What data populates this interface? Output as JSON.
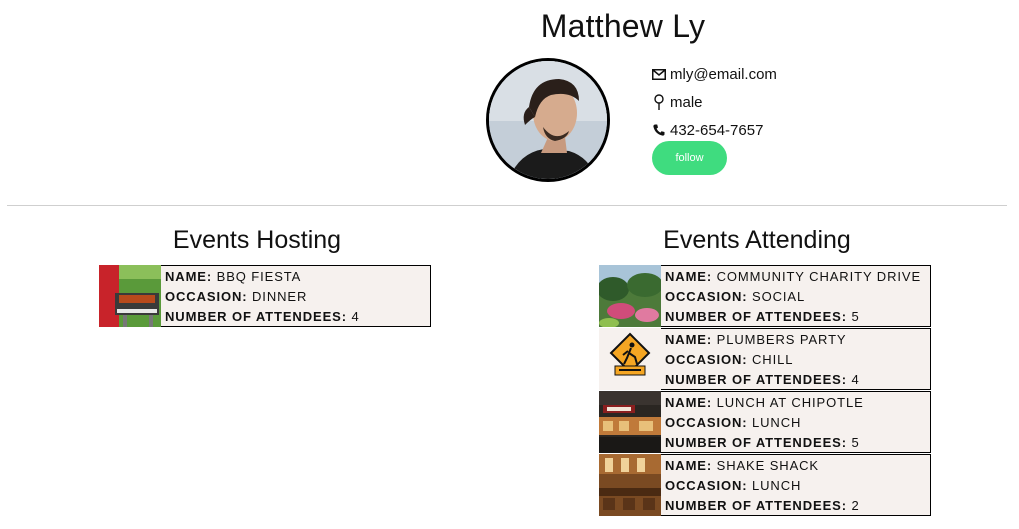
{
  "profile": {
    "name": "Matthew Ly",
    "email": "mly@email.com",
    "gender": "male",
    "phone": "432-654-7657",
    "follow_label": "follow",
    "icons": {
      "email": "envelope-icon",
      "gender": "male-symbol-icon",
      "phone": "phone-icon"
    },
    "accent_color": "#3fdc7f"
  },
  "labels": {
    "name": "NAME:",
    "occasion": "OCCASION:",
    "attendees": "NUMBER OF ATTENDEES:"
  },
  "hosting": {
    "title": "Events Hosting",
    "events": [
      {
        "name": "BBQ FIESTA",
        "occasion": "DINNER",
        "attendees": "4",
        "image": "bbq-grill-photo"
      }
    ]
  },
  "attending": {
    "title": "Events Attending",
    "events": [
      {
        "name": "COMMUNITY CHARITY DRIVE",
        "occasion": "SOCIAL",
        "attendees": "5",
        "image": "garden-photo"
      },
      {
        "name": "PLUMBERS PARTY",
        "occasion": "CHILL",
        "attendees": "4",
        "image": "back-to-work-sign"
      },
      {
        "name": "LUNCH AT CHIPOTLE",
        "occasion": "LUNCH",
        "attendees": "5",
        "image": "chipotle-storefront-photo"
      },
      {
        "name": "SHAKE SHACK",
        "occasion": "LUNCH",
        "attendees": "2",
        "image": "restaurant-interior-photo"
      }
    ]
  }
}
